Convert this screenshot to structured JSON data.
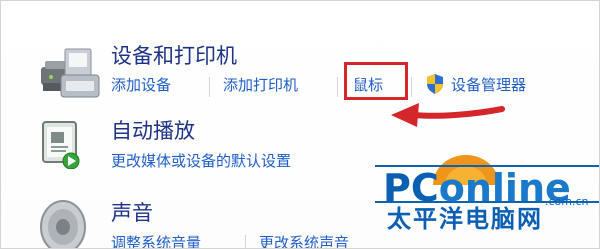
{
  "devices_printers": {
    "title": "设备和打印机",
    "links": {
      "add_device": "添加设备",
      "add_printer": "添加打印机",
      "mouse": "鼠标",
      "device_manager": "设备管理器"
    }
  },
  "autoplay": {
    "title": "自动播放",
    "links": {
      "change_defaults": "更改媒体或设备的默认设置"
    }
  },
  "sound": {
    "title": "声音",
    "links": {
      "adjust_volume": "调整系统音量",
      "change_sounds": "更改系统声音"
    }
  },
  "watermark": {
    "brand_pc": "PC",
    "brand_online": "online",
    "domain": ".com.cn",
    "chinese_name": "太平洋电脑网"
  },
  "colors": {
    "title": "#1e3287",
    "link": "#1f5fc7",
    "callout": "#d4262b",
    "watermark": "#0b62b5"
  }
}
